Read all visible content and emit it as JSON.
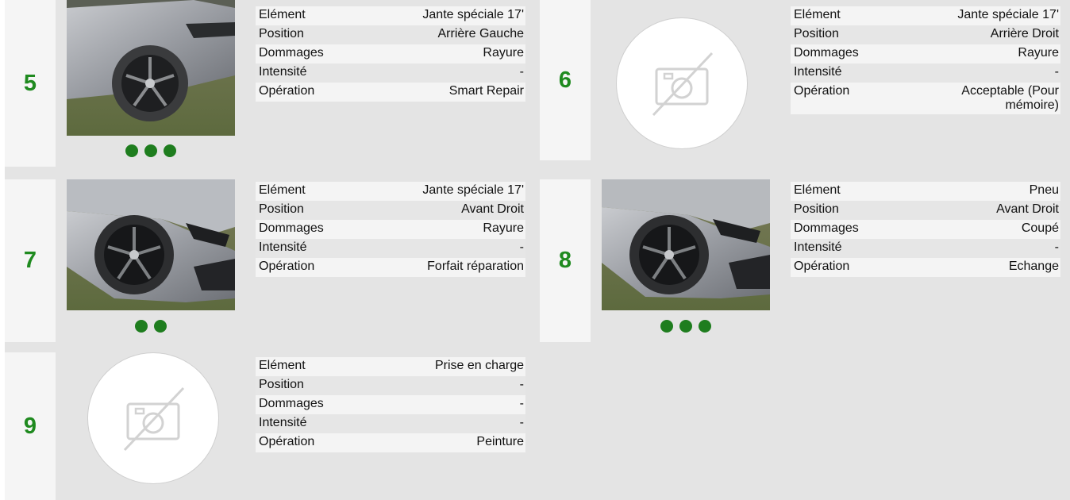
{
  "colors": {
    "accent_green": "#1f8a1f",
    "dot_green": "#1e7d1e"
  },
  "cards": [
    {
      "number": "5",
      "photo": "car-rear-left-wheel-photo",
      "dots": 3,
      "rows": [
        {
          "label": "Elément",
          "value": "Jante spéciale 17'"
        },
        {
          "label": "Position",
          "value": "Arrière Gauche"
        },
        {
          "label": "Dommages",
          "value": "Rayure"
        },
        {
          "label": "Intensité",
          "value": "-"
        },
        {
          "label": "Opération",
          "value": "Smart Repair"
        }
      ]
    },
    {
      "number": "6",
      "photo": "no-photo-icon",
      "dots": 0,
      "rows": [
        {
          "label": "Elément",
          "value": "Jante spéciale 17'"
        },
        {
          "label": "Position",
          "value": "Arrière Droit"
        },
        {
          "label": "Dommages",
          "value": "Rayure"
        },
        {
          "label": "Intensité",
          "value": "-"
        },
        {
          "label": "Opération",
          "value": "Acceptable (Pour mémoire)"
        }
      ]
    },
    {
      "number": "7",
      "photo": "car-front-right-wheel-photo",
      "dots": 2,
      "rows": [
        {
          "label": "Elément",
          "value": "Jante spéciale 17'"
        },
        {
          "label": "Position",
          "value": "Avant Droit"
        },
        {
          "label": "Dommages",
          "value": "Rayure"
        },
        {
          "label": "Intensité",
          "value": "-"
        },
        {
          "label": "Opération",
          "value": "Forfait réparation"
        }
      ]
    },
    {
      "number": "8",
      "photo": "car-front-right-tire-photo",
      "dots": 3,
      "rows": [
        {
          "label": "Elément",
          "value": "Pneu"
        },
        {
          "label": "Position",
          "value": "Avant Droit"
        },
        {
          "label": "Dommages",
          "value": "Coupé"
        },
        {
          "label": "Intensité",
          "value": "-"
        },
        {
          "label": "Opération",
          "value": "Echange"
        }
      ]
    },
    {
      "number": "9",
      "photo": "no-photo-icon",
      "dots": 0,
      "rows": [
        {
          "label": "Elément",
          "value": "Prise en charge"
        },
        {
          "label": "Position",
          "value": "-"
        },
        {
          "label": "Dommages",
          "value": "-"
        },
        {
          "label": "Intensité",
          "value": "-"
        },
        {
          "label": "Opération",
          "value": "Peinture"
        }
      ]
    }
  ]
}
